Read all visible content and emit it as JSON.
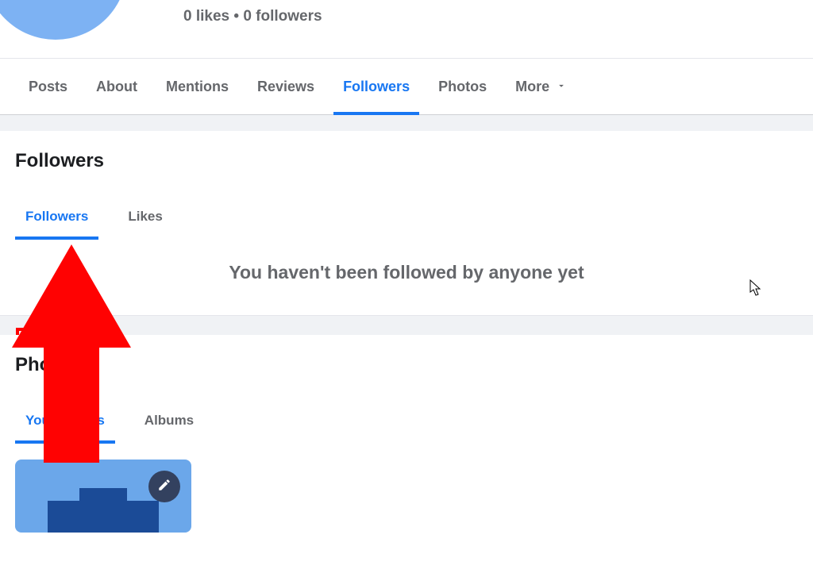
{
  "profile": {
    "stats_text": "0 likes • 0 followers"
  },
  "primary_tabs": [
    {
      "label": "Posts",
      "active": false
    },
    {
      "label": "About",
      "active": false
    },
    {
      "label": "Mentions",
      "active": false
    },
    {
      "label": "Reviews",
      "active": false
    },
    {
      "label": "Followers",
      "active": true
    },
    {
      "label": "Photos",
      "active": false
    },
    {
      "label": "More",
      "active": false,
      "has_carat": true
    }
  ],
  "followers_section": {
    "title": "Followers",
    "subtabs": [
      {
        "label": "Followers",
        "active": true
      },
      {
        "label": "Likes",
        "active": false
      }
    ],
    "empty_state": "You haven't been followed by anyone yet"
  },
  "photos_section": {
    "title": "Photos",
    "subtabs": [
      {
        "label": "Your Photos",
        "active": true
      },
      {
        "label": "Albums",
        "active": false
      }
    ]
  },
  "annotation": {
    "highlight_box": true,
    "arrow": true
  }
}
